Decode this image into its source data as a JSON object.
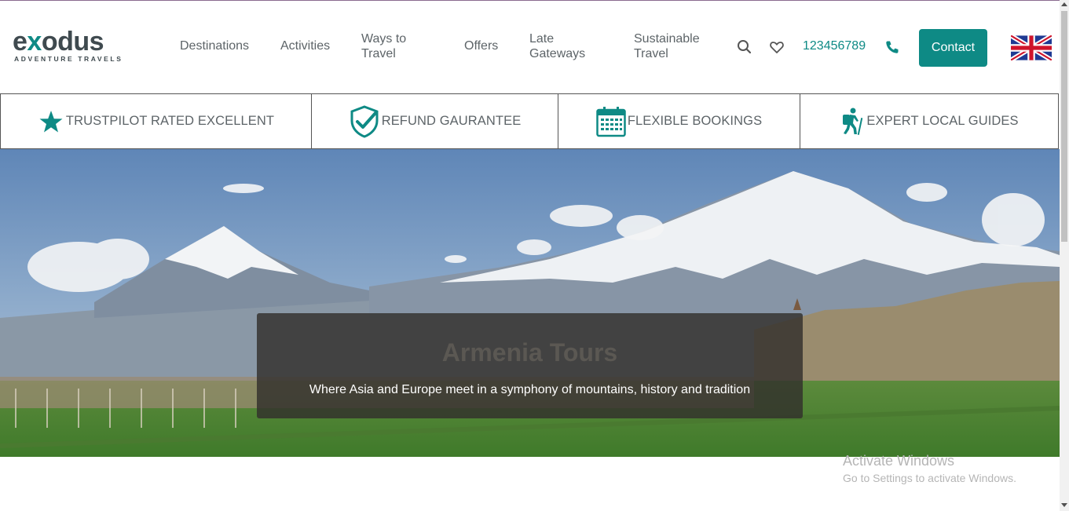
{
  "brand": {
    "logo_text_pre": "e",
    "logo_text_x": "x",
    "logo_text_post": "odus",
    "tagline": "ADVENTURE TRAVELS"
  },
  "nav": {
    "items": [
      {
        "label": "Destinations"
      },
      {
        "label": "Activities"
      },
      {
        "label": "Ways to Travel"
      },
      {
        "label": "Offers"
      },
      {
        "label": "Late Gateways"
      },
      {
        "label": "Sustainable Travel"
      }
    ],
    "search_icon": "search-icon",
    "wishlist_icon": "heart-icon",
    "phone": "123456789",
    "phone_icon": "phone-icon",
    "contact_label": "Contact",
    "language_flag": "uk-flag-icon"
  },
  "features": [
    {
      "icon": "star-icon",
      "label": "TRUSTPILOT RATED EXCELLENT"
    },
    {
      "icon": "shield-check-icon",
      "label": "REFUND GAURANTEE"
    },
    {
      "icon": "calendar-icon",
      "label": "FLEXIBLE BOOKINGS"
    },
    {
      "icon": "hiker-icon",
      "label": "EXPERT LOCAL GUIDES"
    }
  ],
  "hero": {
    "title": "Armenia Tours",
    "subtitle": "Where Asia and Europe meet in a symphony of mountains, history and tradition"
  },
  "watermark": {
    "title": "Activate Windows",
    "subtitle": "Go to Settings to activate Windows."
  },
  "colors": {
    "accent": "#0e8a85",
    "text": "#5d6468",
    "logo": "#3f4a4f"
  }
}
